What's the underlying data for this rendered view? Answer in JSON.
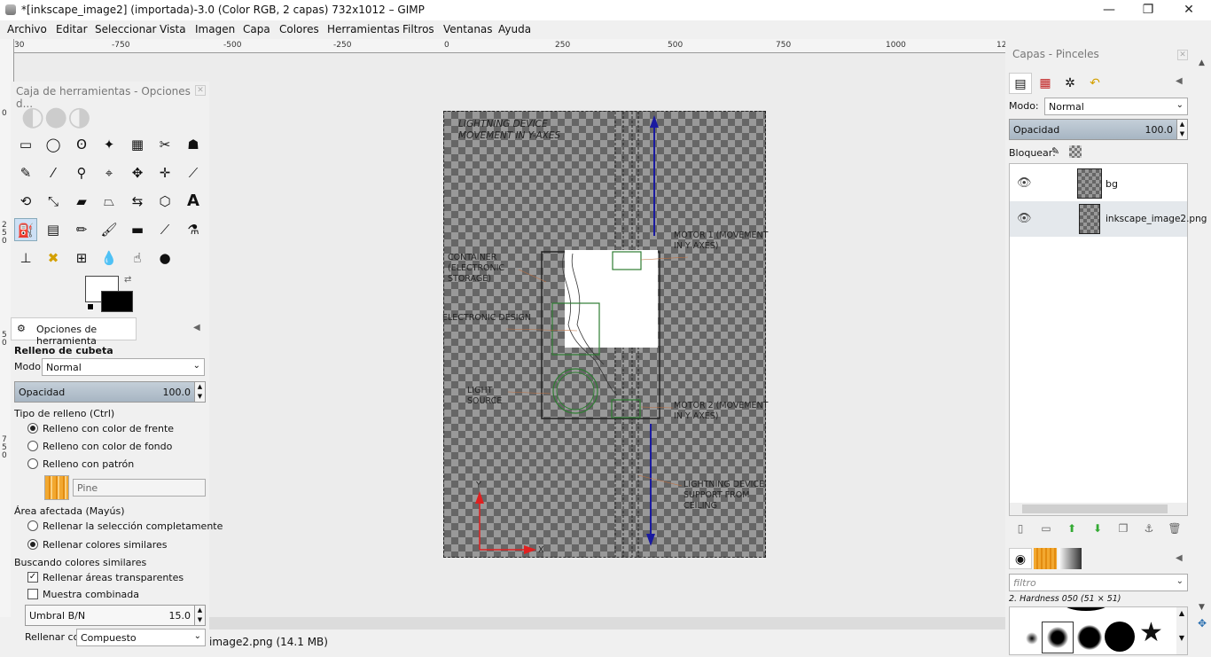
{
  "window": {
    "title": "*[inkscape_image2] (importada)-3.0 (Color RGB, 2 capas) 732x1012 – GIMP",
    "minimize": "—",
    "restore": "❐",
    "close": "✕"
  },
  "menu": [
    "Archivo",
    "Editar",
    "Seleccionar",
    "Vista",
    "Imagen",
    "Capa",
    "Colores",
    "Herramientas",
    "Filtros",
    "Ventanas",
    "Ayuda"
  ],
  "ruler": {
    "h_ticks": [
      "30",
      "-750",
      "-500",
      "-250",
      "0",
      "250",
      "500",
      "750",
      "1000",
      "12"
    ],
    "v_ticks": [
      "0",
      "2\n5\n0",
      "5\n0",
      "7\n5\n0"
    ]
  },
  "diagram": {
    "title": "LIGHTNING DEVICE\nMOVEMENT IN Y-AXES",
    "labels": {
      "container": "CONTAINER\n(ELECTRONIC\nSTORAGE)",
      "electronic_design": "ELECTRONIC DESIGN",
      "light_source": "LIGHT\nSOURCE",
      "motor1": "MOTOR 1 (MOVEMENT\nIN Y AXES)",
      "motor2": "MOTOR 2 (MOVEMENT\nIN Y AXES)",
      "support": "LIGHTNING DEVICE\nSUPPORT FROM\nCEILING",
      "y_axis": "Y",
      "x_axis": "X"
    }
  },
  "status": {
    "text": "image2.png (14.1 MB)"
  },
  "toolbox": {
    "title": "Caja de herramientas - Opciones d...",
    "tool_options_tab": "Opciones de herramienta",
    "tool_name": "Relleno de cubeta",
    "mode_label": "Modo:",
    "mode_value": "Normal",
    "opacity_label": "Opacidad",
    "opacity_value": "100.0",
    "fill_type_label": "Tipo de relleno  (Ctrl)",
    "fill_fg": "Relleno con color de frente",
    "fill_bg": "Relleno con color de fondo",
    "fill_pattern": "Relleno con patrón",
    "pattern_name": "Pine",
    "affected_area_label": "Área afectada  (Mayús)",
    "fill_selection": "Rellenar la selección completamente",
    "fill_similar": "Rellenar colores similares",
    "finding_label": "Buscando colores similares",
    "fill_transparent": "Rellenar áreas transparentes",
    "sample_merged": "Muestra combinada",
    "threshold_label": "Umbral B/N",
    "threshold_value": "15.0",
    "fill_by_label": "Rellenar con:",
    "fill_by_value": "Compuesto"
  },
  "dock": {
    "title": "Capas - Pinceles",
    "mode_label": "Modo:",
    "mode_value": "Normal",
    "opacity_label": "Opacidad",
    "opacity_value": "100.0",
    "lock_label": "Bloquear:",
    "layers": [
      {
        "name": "bg"
      },
      {
        "name": "inkscape_image2.png"
      }
    ],
    "filter_placeholder": "filtro",
    "brush_name": "2. Hardness 050 (51 × 51)"
  },
  "colors": {
    "accent": "#cde0f5",
    "diagram_green": "#2e7d32",
    "diagram_blue": "#1a1aa0",
    "axis_red": "#e02020"
  }
}
